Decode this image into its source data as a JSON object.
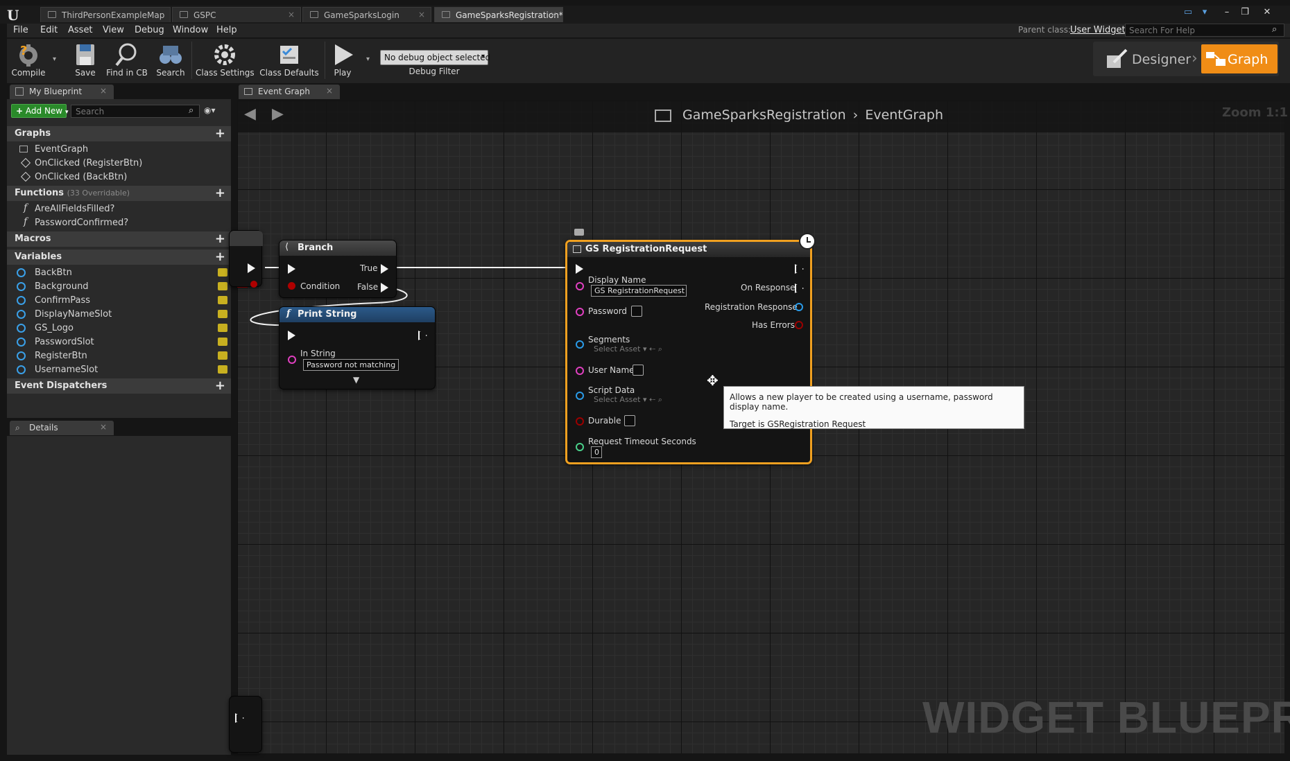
{
  "window": {
    "tabs": [
      {
        "label": "ThirdPersonExampleMap",
        "active": false
      },
      {
        "label": "GSPC",
        "active": false
      },
      {
        "label": "GameSparksLogin",
        "active": false
      },
      {
        "label": "GameSparksRegistration*",
        "active": true
      }
    ]
  },
  "menu": [
    "File",
    "Edit",
    "Asset",
    "View",
    "Debug",
    "Window",
    "Help"
  ],
  "parent_class": {
    "label": "Parent class:",
    "value": "User Widget"
  },
  "help_search": {
    "placeholder": "Search For Help"
  },
  "toolbar": {
    "compile": "Compile",
    "save": "Save",
    "find_in_cb": "Find in CB",
    "search": "Search",
    "class_settings": "Class Settings",
    "class_defaults": "Class Defaults",
    "play": "Play",
    "debug_select": "No debug object selected",
    "debug_filter": "Debug Filter"
  },
  "modes": {
    "designer": "Designer",
    "graph": "Graph"
  },
  "my_blueprint": {
    "tab": "My Blueprint",
    "add_new": "Add New",
    "search_placeholder": "Search",
    "graphs_header": "Graphs",
    "graphs": {
      "root": "EventGraph",
      "events": [
        "OnClicked (RegisterBtn)",
        "OnClicked (BackBtn)"
      ]
    },
    "functions_header": "Functions",
    "functions_sub": "(33 Overridable)",
    "functions": [
      "AreAllFieldsFilled?",
      "PasswordConfirmed?"
    ],
    "macros_header": "Macros",
    "variables_header": "Variables",
    "variables": [
      "BackBtn",
      "Background",
      "ConfirmPass",
      "DisplayNameSlot",
      "GS_Logo",
      "PasswordSlot",
      "RegisterBtn",
      "UsernameSlot"
    ],
    "dispatchers_header": "Event Dispatchers"
  },
  "details": {
    "tab": "Details"
  },
  "graph": {
    "tab": "Event Graph",
    "breadcrumb": {
      "blueprint": "GameSparksRegistration",
      "graph": "EventGraph"
    },
    "zoom": "Zoom 1:1",
    "watermark": "WIDGET BLUEPRINT",
    "branch_node": {
      "title": "Branch",
      "true": "True",
      "false": "False",
      "condition": "Condition"
    },
    "print_node": {
      "title": "Print String",
      "in_string": "In String",
      "value": "Password not matching"
    },
    "gs_node": {
      "title": "GS RegistrationRequest",
      "display_name": "Display Name",
      "display_name_value": "GS RegistrationRequest",
      "password": "Password",
      "segments": "Segments",
      "select_asset": "Select Asset",
      "user_name": "User Name",
      "script_data": "Script Data",
      "durable": "Durable",
      "timeout": "Request Timeout Seconds",
      "timeout_value": "0",
      "on_response": "On Response",
      "registration_response": "Registration Response",
      "has_errors": "Has Errors"
    },
    "tooltip": {
      "line1": "Allows a new player to be created using a username, password display name.",
      "line2": "Target is GSRegistration Request"
    }
  },
  "colors": {
    "accent": "#f08d16",
    "exec": "#f2f2f2",
    "string_pin": "#e040c0",
    "struct_pin": "#2a9be8",
    "bool_pin": "#9b0000",
    "float_pin": "#4ad08a"
  }
}
